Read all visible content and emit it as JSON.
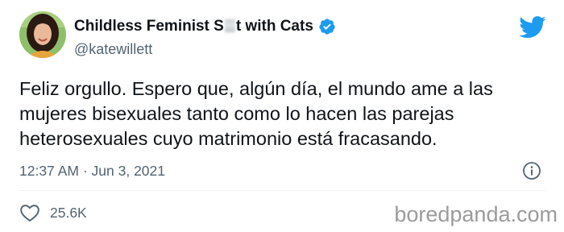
{
  "author": {
    "display_name_before": "Childless Feminist S",
    "display_name_after": "t with Cats",
    "handle": "@katewillett",
    "verified": true
  },
  "tweet": {
    "lines": [
      "Feliz orgullo. Espero que, algún día, el mundo ame a las",
      "mujeres bisexuales tanto como lo hacen las parejas",
      "heterosexuales cuyo matrimonio está fracasando."
    ],
    "time": "12:37 AM",
    "separator": "·",
    "date": "Jun 3, 2021"
  },
  "engagement": {
    "likes": "25.6K"
  },
  "watermark": "boredpanda.com",
  "icons": {
    "avatar": "avatar",
    "verified": "verified-badge-icon",
    "platform": "twitter-bird-icon",
    "info": "info-icon",
    "like": "heart-icon"
  },
  "colors": {
    "brand_blue": "#1d9bf0",
    "text_primary": "#0f1419",
    "text_secondary": "#536471",
    "watermark": "#9b9b9b"
  }
}
